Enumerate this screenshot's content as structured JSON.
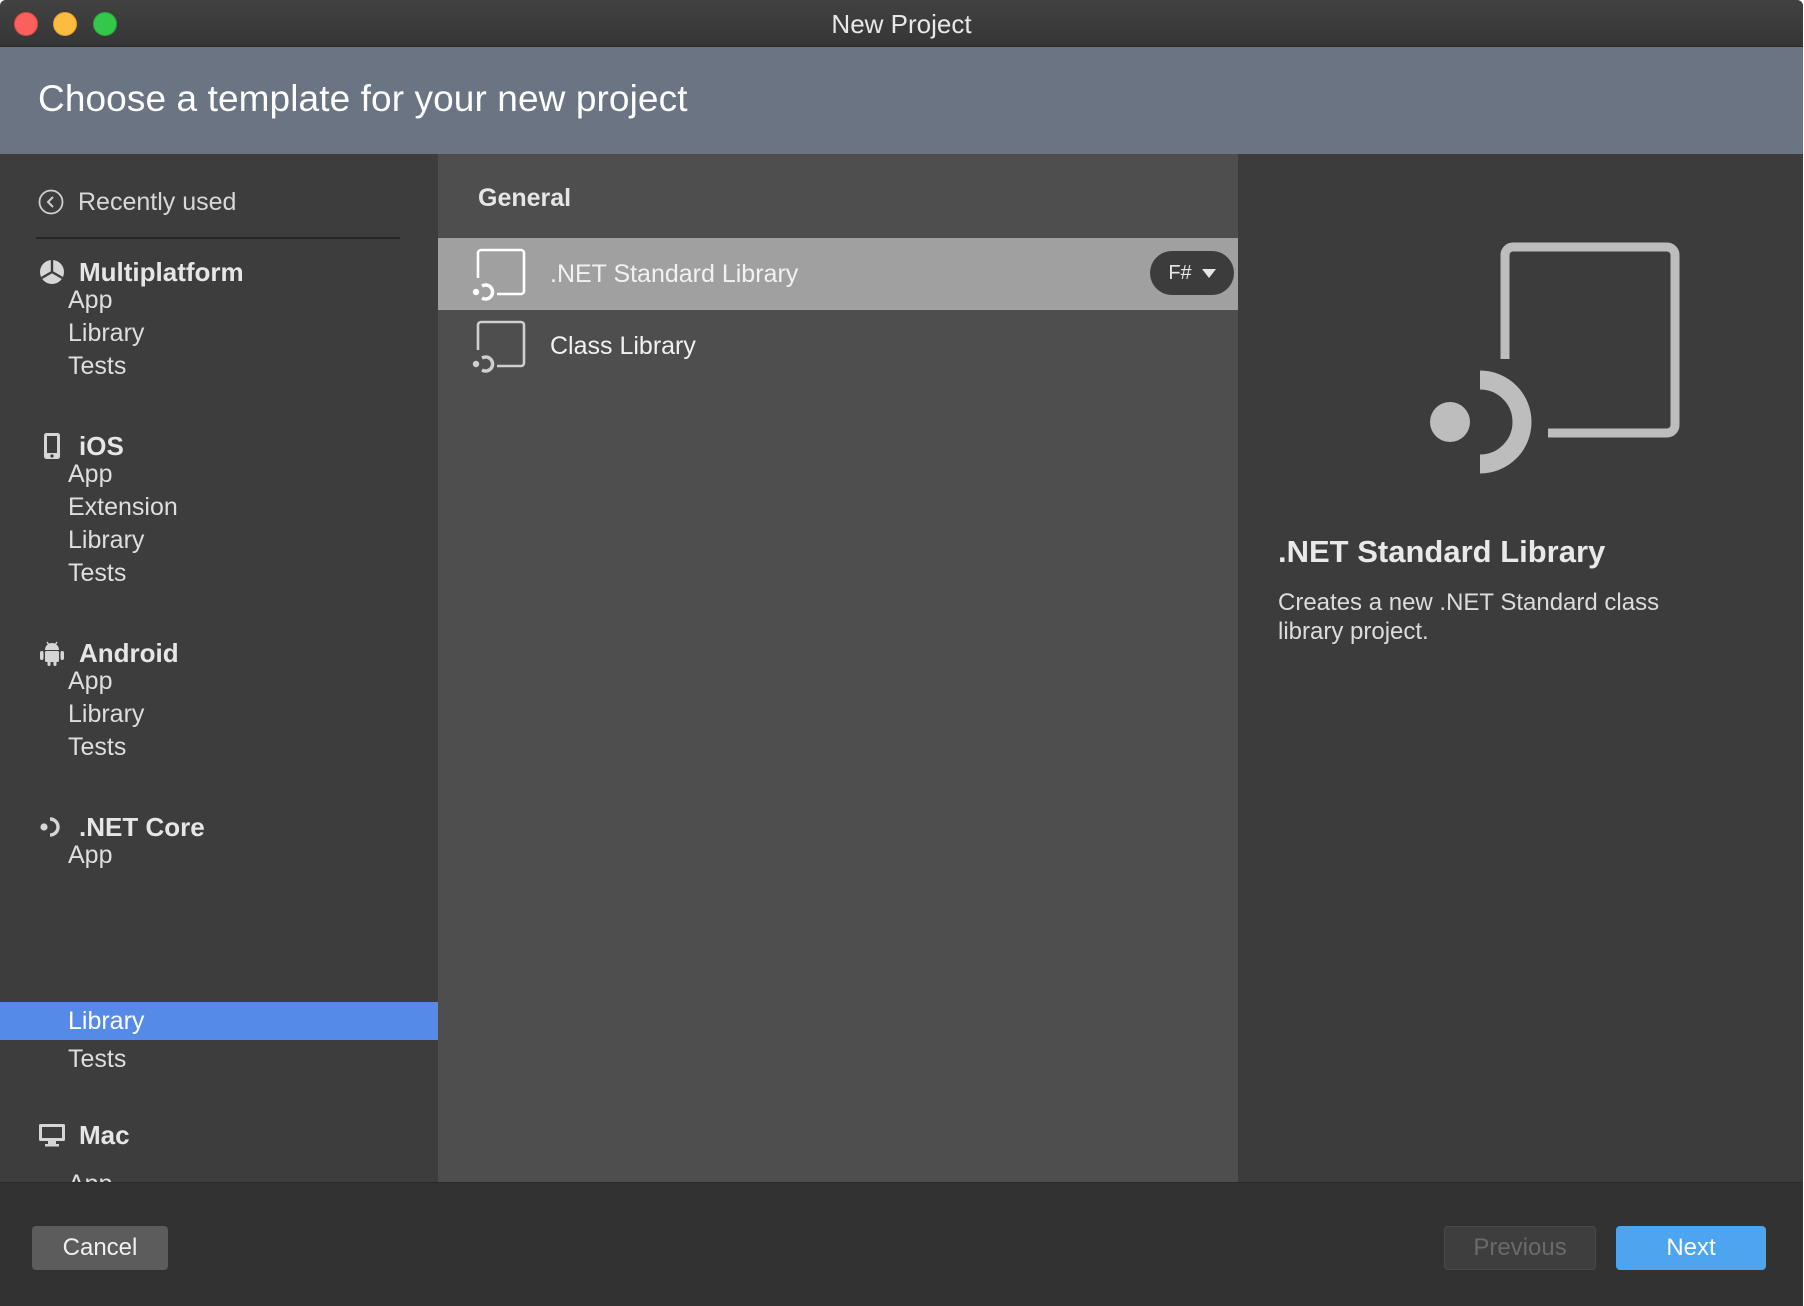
{
  "window": {
    "title": "New Project"
  },
  "header": {
    "title": "Choose a template for your new project"
  },
  "sidebar": {
    "recent": {
      "label": "Recently used",
      "icon": "clock-icon"
    },
    "categories": [
      {
        "name": "Multiplatform",
        "icon": "multiplatform-icon",
        "items": [
          "App",
          "Library",
          "Tests"
        ]
      },
      {
        "name": "iOS",
        "icon": "phone-icon",
        "items": [
          "App",
          "Extension",
          "Library",
          "Tests"
        ]
      },
      {
        "name": "Android",
        "icon": "android-icon",
        "items": [
          "App",
          "Library",
          "Tests"
        ]
      },
      {
        "name": ".NET Core",
        "icon": "dotnet-icon",
        "items": [
          "App",
          "Library",
          "Tests"
        ]
      },
      {
        "name": "Mac",
        "icon": "monitor-icon",
        "items": [
          "App"
        ]
      }
    ],
    "selected": ".NET Core / Library"
  },
  "templates": {
    "group": "General",
    "items": [
      {
        "name": ".NET Standard Library",
        "selected": true,
        "language": "F#"
      },
      {
        "name": "Class Library",
        "selected": false
      }
    ]
  },
  "detail": {
    "title": ".NET Standard Library",
    "description": "Creates a new .NET Standard class library project."
  },
  "footer": {
    "cancel_label": "Cancel",
    "previous_label": "Previous",
    "next_label": "Next"
  },
  "colors": {
    "selection": "#568ae8",
    "header_band": "#6a7482",
    "next_button": "#4da5ef"
  }
}
